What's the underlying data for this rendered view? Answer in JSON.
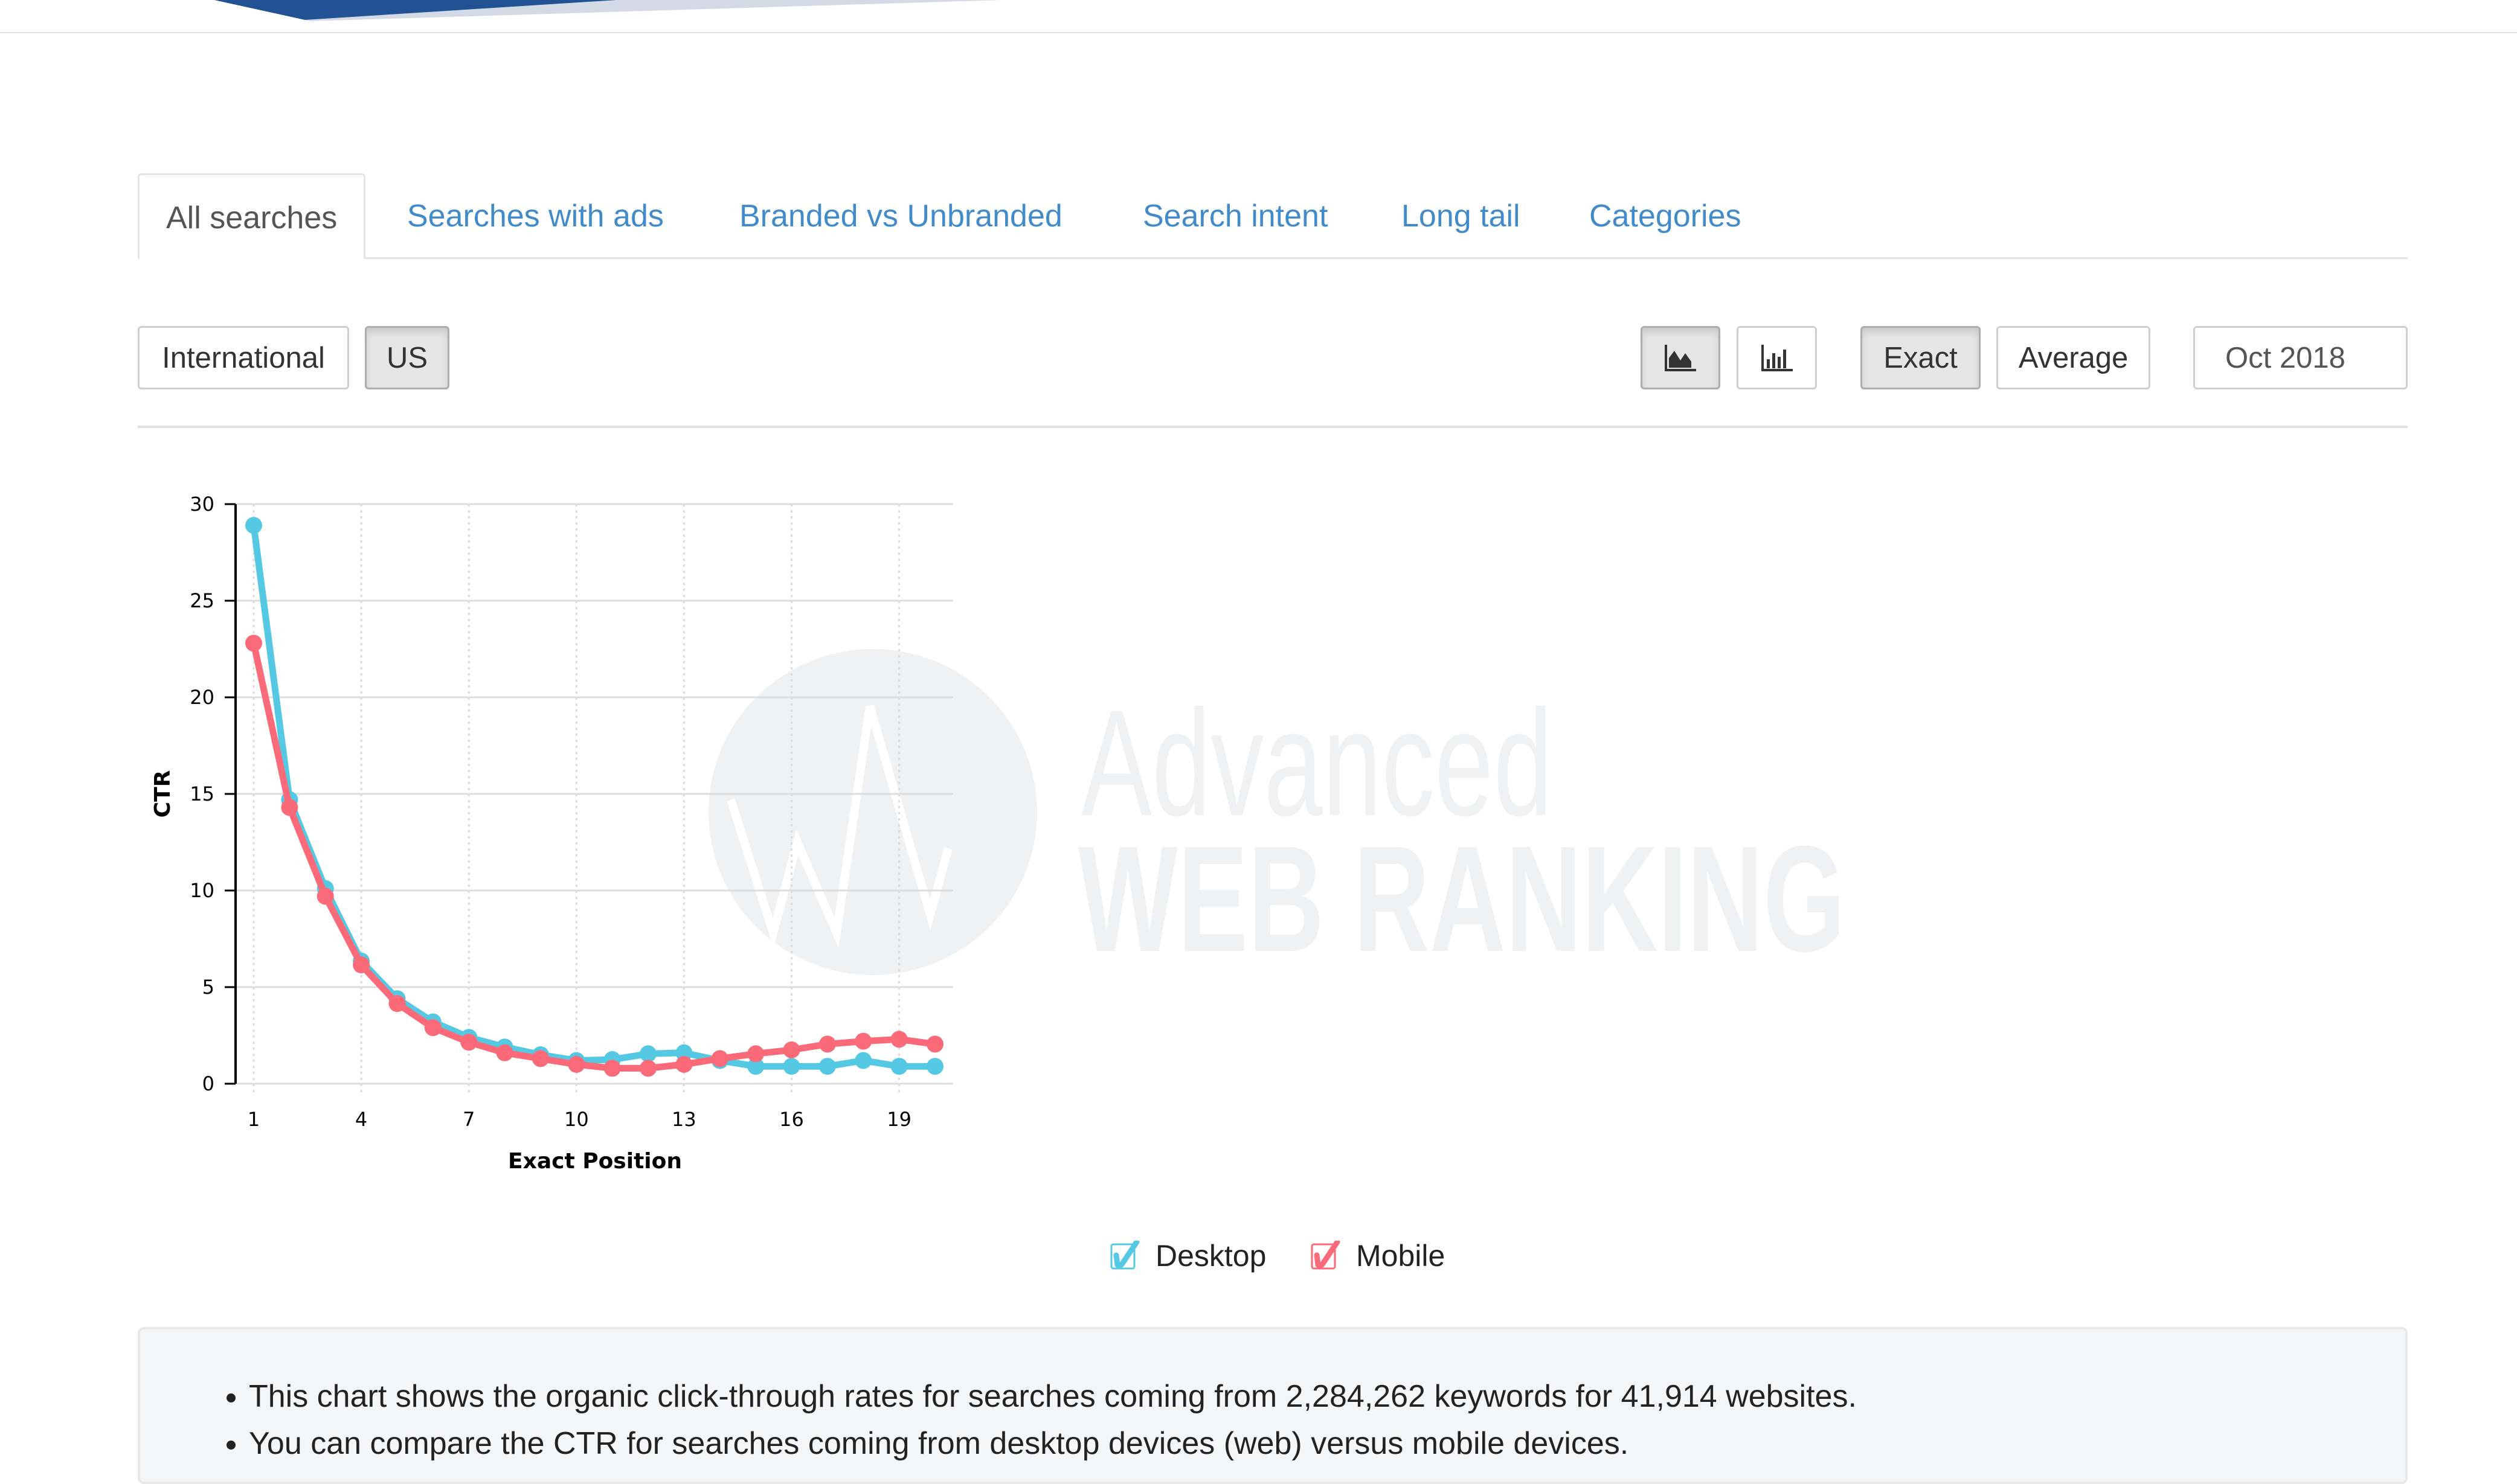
{
  "tabs": [
    {
      "label": "All searches",
      "active": true
    },
    {
      "label": "Searches with ads",
      "active": false
    },
    {
      "label": "Branded vs Unbranded",
      "active": false
    },
    {
      "label": "Search intent",
      "active": false
    },
    {
      "label": "Long tail",
      "active": false
    },
    {
      "label": "Categories",
      "active": false
    }
  ],
  "region_buttons": [
    {
      "label": "International",
      "selected": false
    },
    {
      "label": "US",
      "selected": true
    }
  ],
  "chart_type_buttons": [
    {
      "icon": "area-chart-icon",
      "selected": true
    },
    {
      "icon": "bar-chart-icon",
      "selected": false
    }
  ],
  "mode_buttons": [
    {
      "label": "Exact",
      "selected": true
    },
    {
      "label": "Average",
      "selected": false
    }
  ],
  "date_selector": {
    "value": "Oct 2018"
  },
  "watermark": {
    "line1": "Advanced",
    "line2": "WEB RANKING"
  },
  "colors": {
    "desktop": "#55c9e3",
    "mobile": "#fa6a78",
    "link": "#428bca"
  },
  "chart_data": {
    "type": "line",
    "title": "",
    "xlabel": "Exact Position",
    "ylabel": "CTR",
    "x": [
      1,
      2,
      3,
      4,
      5,
      6,
      7,
      8,
      9,
      10,
      11,
      12,
      13,
      14,
      15,
      16,
      17,
      18,
      19,
      20
    ],
    "xticks": [
      1,
      4,
      7,
      10,
      13,
      16,
      19
    ],
    "yticks": [
      0,
      5,
      10,
      15,
      20,
      25,
      30
    ],
    "ylim": [
      0,
      30
    ],
    "xlim": [
      0.5,
      20.6
    ],
    "grid": true,
    "legend_position": "bottom-center",
    "series": [
      {
        "name": "Desktop",
        "color": "#55c9e3",
        "checked": true,
        "values": [
          28.9,
          14.7,
          10.1,
          6.35,
          4.4,
          3.2,
          2.4,
          1.9,
          1.5,
          1.2,
          1.25,
          1.55,
          1.6,
          1.2,
          0.9,
          0.9,
          0.9,
          1.2,
          0.9,
          0.9
        ]
      },
      {
        "name": "Mobile",
        "color": "#fa6a78",
        "checked": true,
        "values": [
          22.8,
          14.3,
          9.7,
          6.15,
          4.15,
          2.9,
          2.15,
          1.6,
          1.3,
          1.0,
          0.8,
          0.8,
          1.0,
          1.3,
          1.55,
          1.75,
          2.05,
          2.2,
          2.3,
          2.05
        ]
      }
    ]
  },
  "info": {
    "bullets": [
      "This chart shows the organic click-through rates for searches coming from 2,284,262 keywords for 41,914 websites.",
      "You can compare the CTR for searches coming from desktop devices (web) versus mobile devices."
    ]
  }
}
